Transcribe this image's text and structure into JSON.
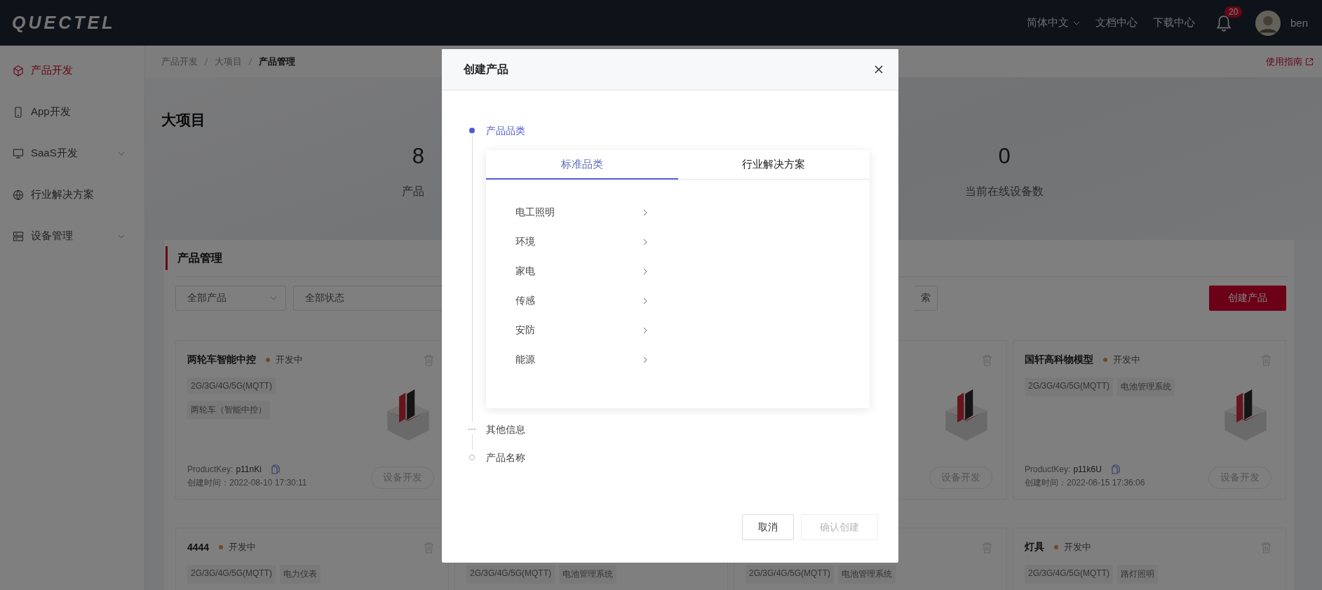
{
  "header": {
    "logo": "QUECTEL",
    "language": "简体中文",
    "links": [
      "文档中心",
      "下载中心"
    ],
    "notification_count": "20",
    "user": "ben"
  },
  "sidebar": {
    "items": [
      {
        "label": "产品开发",
        "selected": true,
        "expandable": false
      },
      {
        "label": "App开发",
        "selected": false,
        "expandable": false
      },
      {
        "label": "SaaS开发",
        "selected": false,
        "expandable": true
      },
      {
        "label": "行业解决方案",
        "selected": false,
        "expandable": false
      },
      {
        "label": "设备管理",
        "selected": false,
        "expandable": true
      }
    ]
  },
  "breadcrumb": [
    "产品开发",
    "大项目",
    "产品管理"
  ],
  "guide_link": "使用指南",
  "project": {
    "title": "大项目",
    "stats": [
      {
        "value": "8",
        "label": "产品"
      },
      {
        "value": "0",
        "label": "当前在线设备数"
      }
    ]
  },
  "products": {
    "title": "产品管理",
    "filters": [
      "全部产品",
      "全部状态"
    ],
    "search_button": "索",
    "create_button": "创建产品",
    "cards": [
      {
        "title": "两轮车智能中控",
        "status": "开发中",
        "tags": [
          "2G/3G/4G/5G(MQTT)",
          "两轮车（智能中控）"
        ],
        "product_key_label": "ProductKey:",
        "product_key": "p11nKi",
        "created": "创建时间：2022-08-10 17:30:11",
        "action": "设备开发"
      },
      {
        "action": "设备开发"
      },
      {
        "title": "国轩高科物模型",
        "status": "开发中",
        "tags": [
          "2G/3G/4G/5G(MQTT)",
          "电池管理系统"
        ],
        "product_key_label": "ProductKey:",
        "product_key": "p11k6U",
        "created": "创建时间：2022-06-15 17:36:06",
        "action": "设备开发"
      },
      {
        "title": "4444",
        "status": "开发中",
        "tags": [
          "2G/3G/4G/5G(MQTT)",
          "电力仪表"
        ]
      },
      {
        "tags": [
          "2G/3G/4G/5G(MQTT)",
          "电池管理系统"
        ]
      },
      {
        "tags": [
          "2G/3G/4G/5G(MQTT)",
          "电池管理系统"
        ]
      },
      {
        "title": "灯具",
        "status": "开发中",
        "tags": [
          "2G/3G/4G/5G(MQTT)",
          "路灯照明"
        ]
      }
    ]
  },
  "dialog": {
    "title": "创建产品",
    "steps": [
      {
        "label": "产品品类",
        "kind": "current"
      },
      {
        "label": "其他信息",
        "kind": "collapsed"
      },
      {
        "label": "产品名称",
        "kind": "wait"
      }
    ],
    "tabs": [
      {
        "label": "标准品类",
        "selected": true
      },
      {
        "label": "行业解决方案",
        "selected": false
      }
    ],
    "categories": [
      "电工照明",
      "环境",
      "家电",
      "传感",
      "安防",
      "能源"
    ],
    "buttons": [
      {
        "label": "取消",
        "disabled": false
      },
      {
        "label": "确认创建",
        "disabled": true
      }
    ]
  }
}
